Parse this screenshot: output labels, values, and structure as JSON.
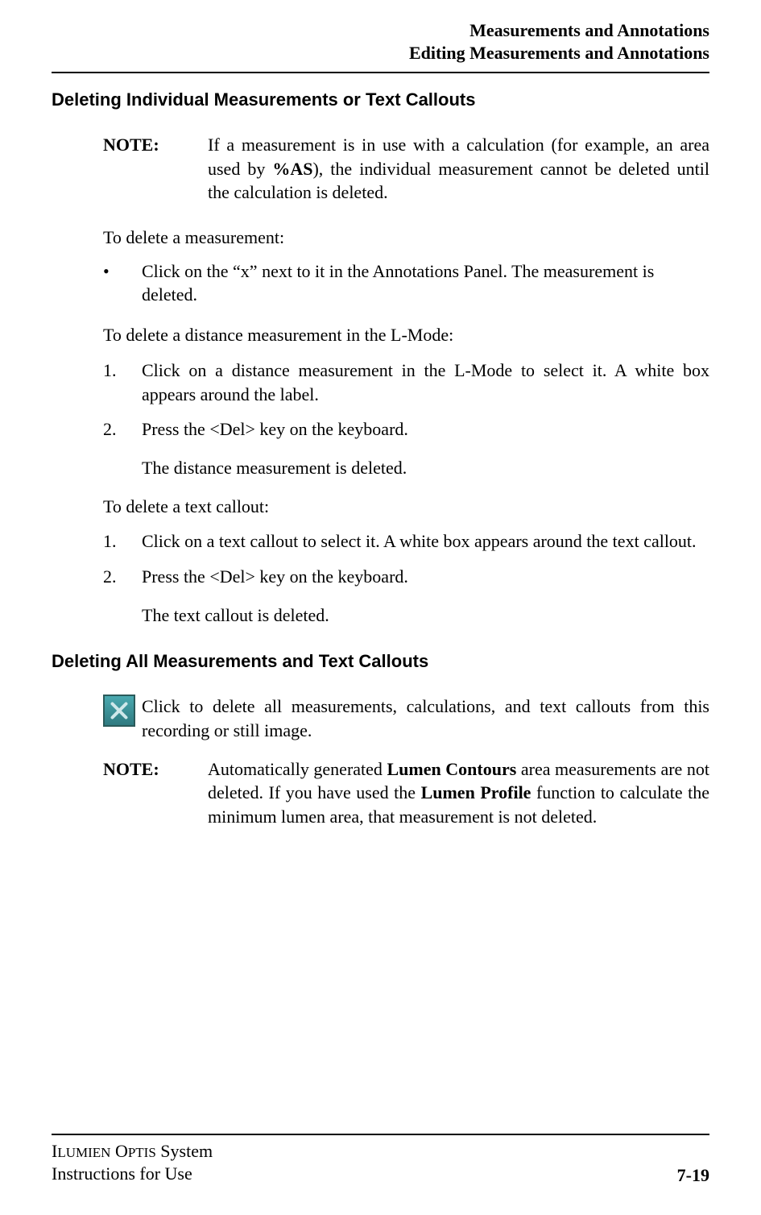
{
  "header": {
    "line1": "Measurements and Annotations",
    "line2": "Editing Measurements and Annotations"
  },
  "section1": {
    "heading": "Deleting Individual Measurements or Text Callouts",
    "note_label": "NOTE:",
    "note_pre": "If a measurement is in use with a calculation (for example, an area used by ",
    "note_bold": "%AS",
    "note_post": "), the individual measurement cannot be deleted until the calculation is deleted.",
    "p_delete_measure": "To delete a measurement:",
    "bullet_mark": "•",
    "bullet_text": "Click on the “x” next to it in the Annotations Panel. The measurement is deleted.",
    "p_delete_distance": "To delete a distance measurement in the L-Mode:",
    "dist_step1_num": "1.",
    "dist_step1_text": "Click on a distance measurement in the L-Mode to select it. A white box appears around the label.",
    "dist_step2_num": "2.",
    "dist_step2_text": "Press the <Del> key on the keyboard.",
    "dist_result": "The distance measurement is deleted.",
    "p_delete_callout": "To delete a text callout:",
    "call_step1_num": "1.",
    "call_step1_text": "Click on a text callout to select it. A white box appears around the text callout.",
    "call_step2_num": "2.",
    "call_step2_text": "Press the <Del> key on the keyboard.",
    "call_result": "The text callout is deleted."
  },
  "section2": {
    "heading": "Deleting All Measurements and Text Callouts",
    "icon_text": "Click to delete all measurements, calculations, and text callouts from this recording or still image.",
    "note_label": "NOTE:",
    "note_pre": "Automatically generated ",
    "note_bold1": "Lumen Contours",
    "note_mid": " area measurements are not deleted. If you have used the ",
    "note_bold2": "Lumen Profile",
    "note_post": " function to calculate the min­imum lumen area, that measurement is not deleted."
  },
  "footer": {
    "line1_sc1": "I",
    "line1_rest1": "LUMIEN",
    "line1_sc2": " O",
    "line1_rest2": "PTIS",
    "line1_tail": " System",
    "line2": "Instructions for Use",
    "page": "7-19"
  }
}
